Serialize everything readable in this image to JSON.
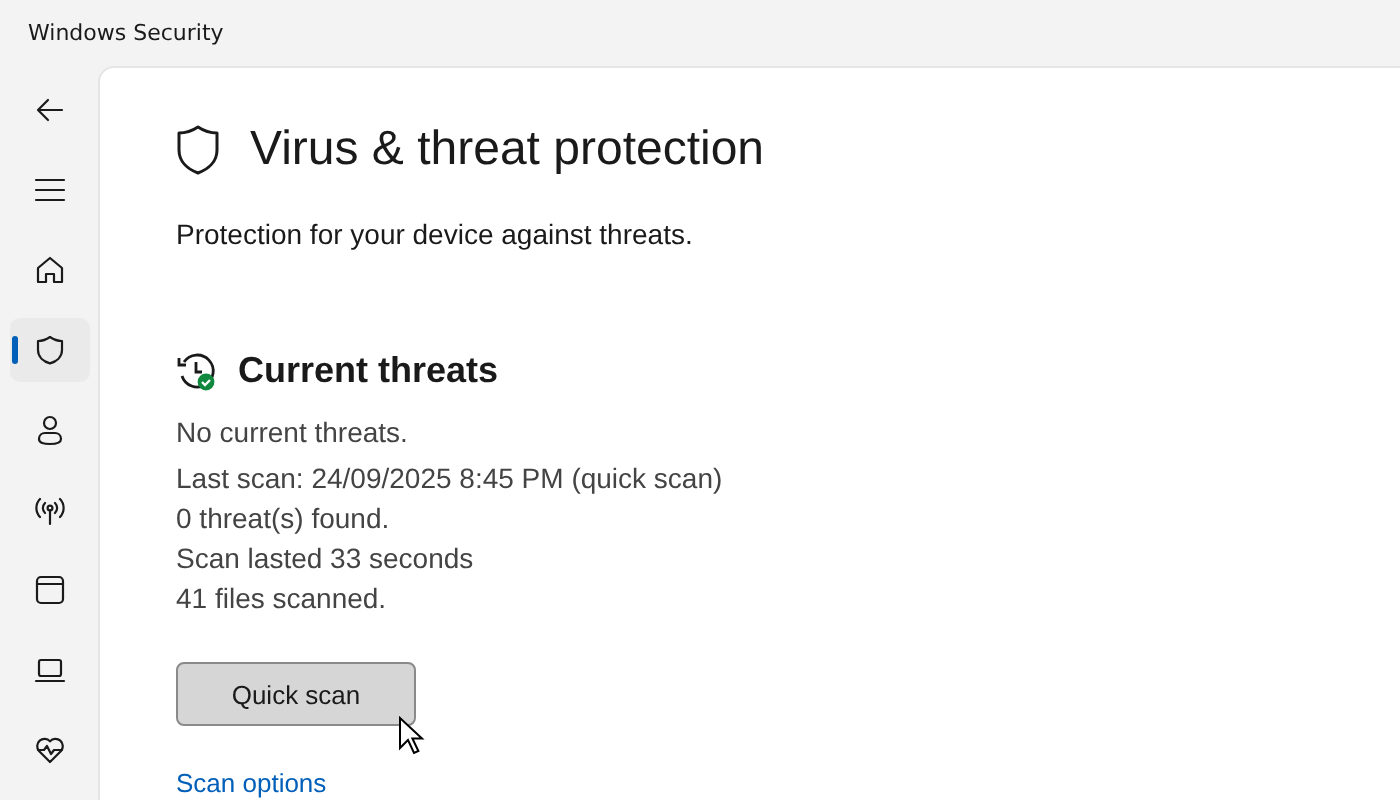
{
  "window": {
    "title": "Windows Security"
  },
  "nav": [
    {
      "kind": "back",
      "selected": false
    },
    {
      "kind": "menu",
      "selected": false
    },
    {
      "kind": "home",
      "selected": false
    },
    {
      "kind": "shield",
      "selected": true
    },
    {
      "kind": "person",
      "selected": false
    },
    {
      "kind": "wireless",
      "selected": false
    },
    {
      "kind": "browser",
      "selected": false
    },
    {
      "kind": "laptop",
      "selected": false
    },
    {
      "kind": "health",
      "selected": false
    }
  ],
  "page": {
    "title": "Virus & threat protection",
    "subtitle": "Protection for your device against threats."
  },
  "current_threats": {
    "heading": "Current threats",
    "status": "No current threats.",
    "details": [
      "Last scan: 24/09/2025 8:45 PM (quick scan)",
      "0 threat(s) found.",
      "Scan lasted 33 seconds",
      "41 files scanned."
    ],
    "button": "Quick scan",
    "link": "Scan options"
  }
}
